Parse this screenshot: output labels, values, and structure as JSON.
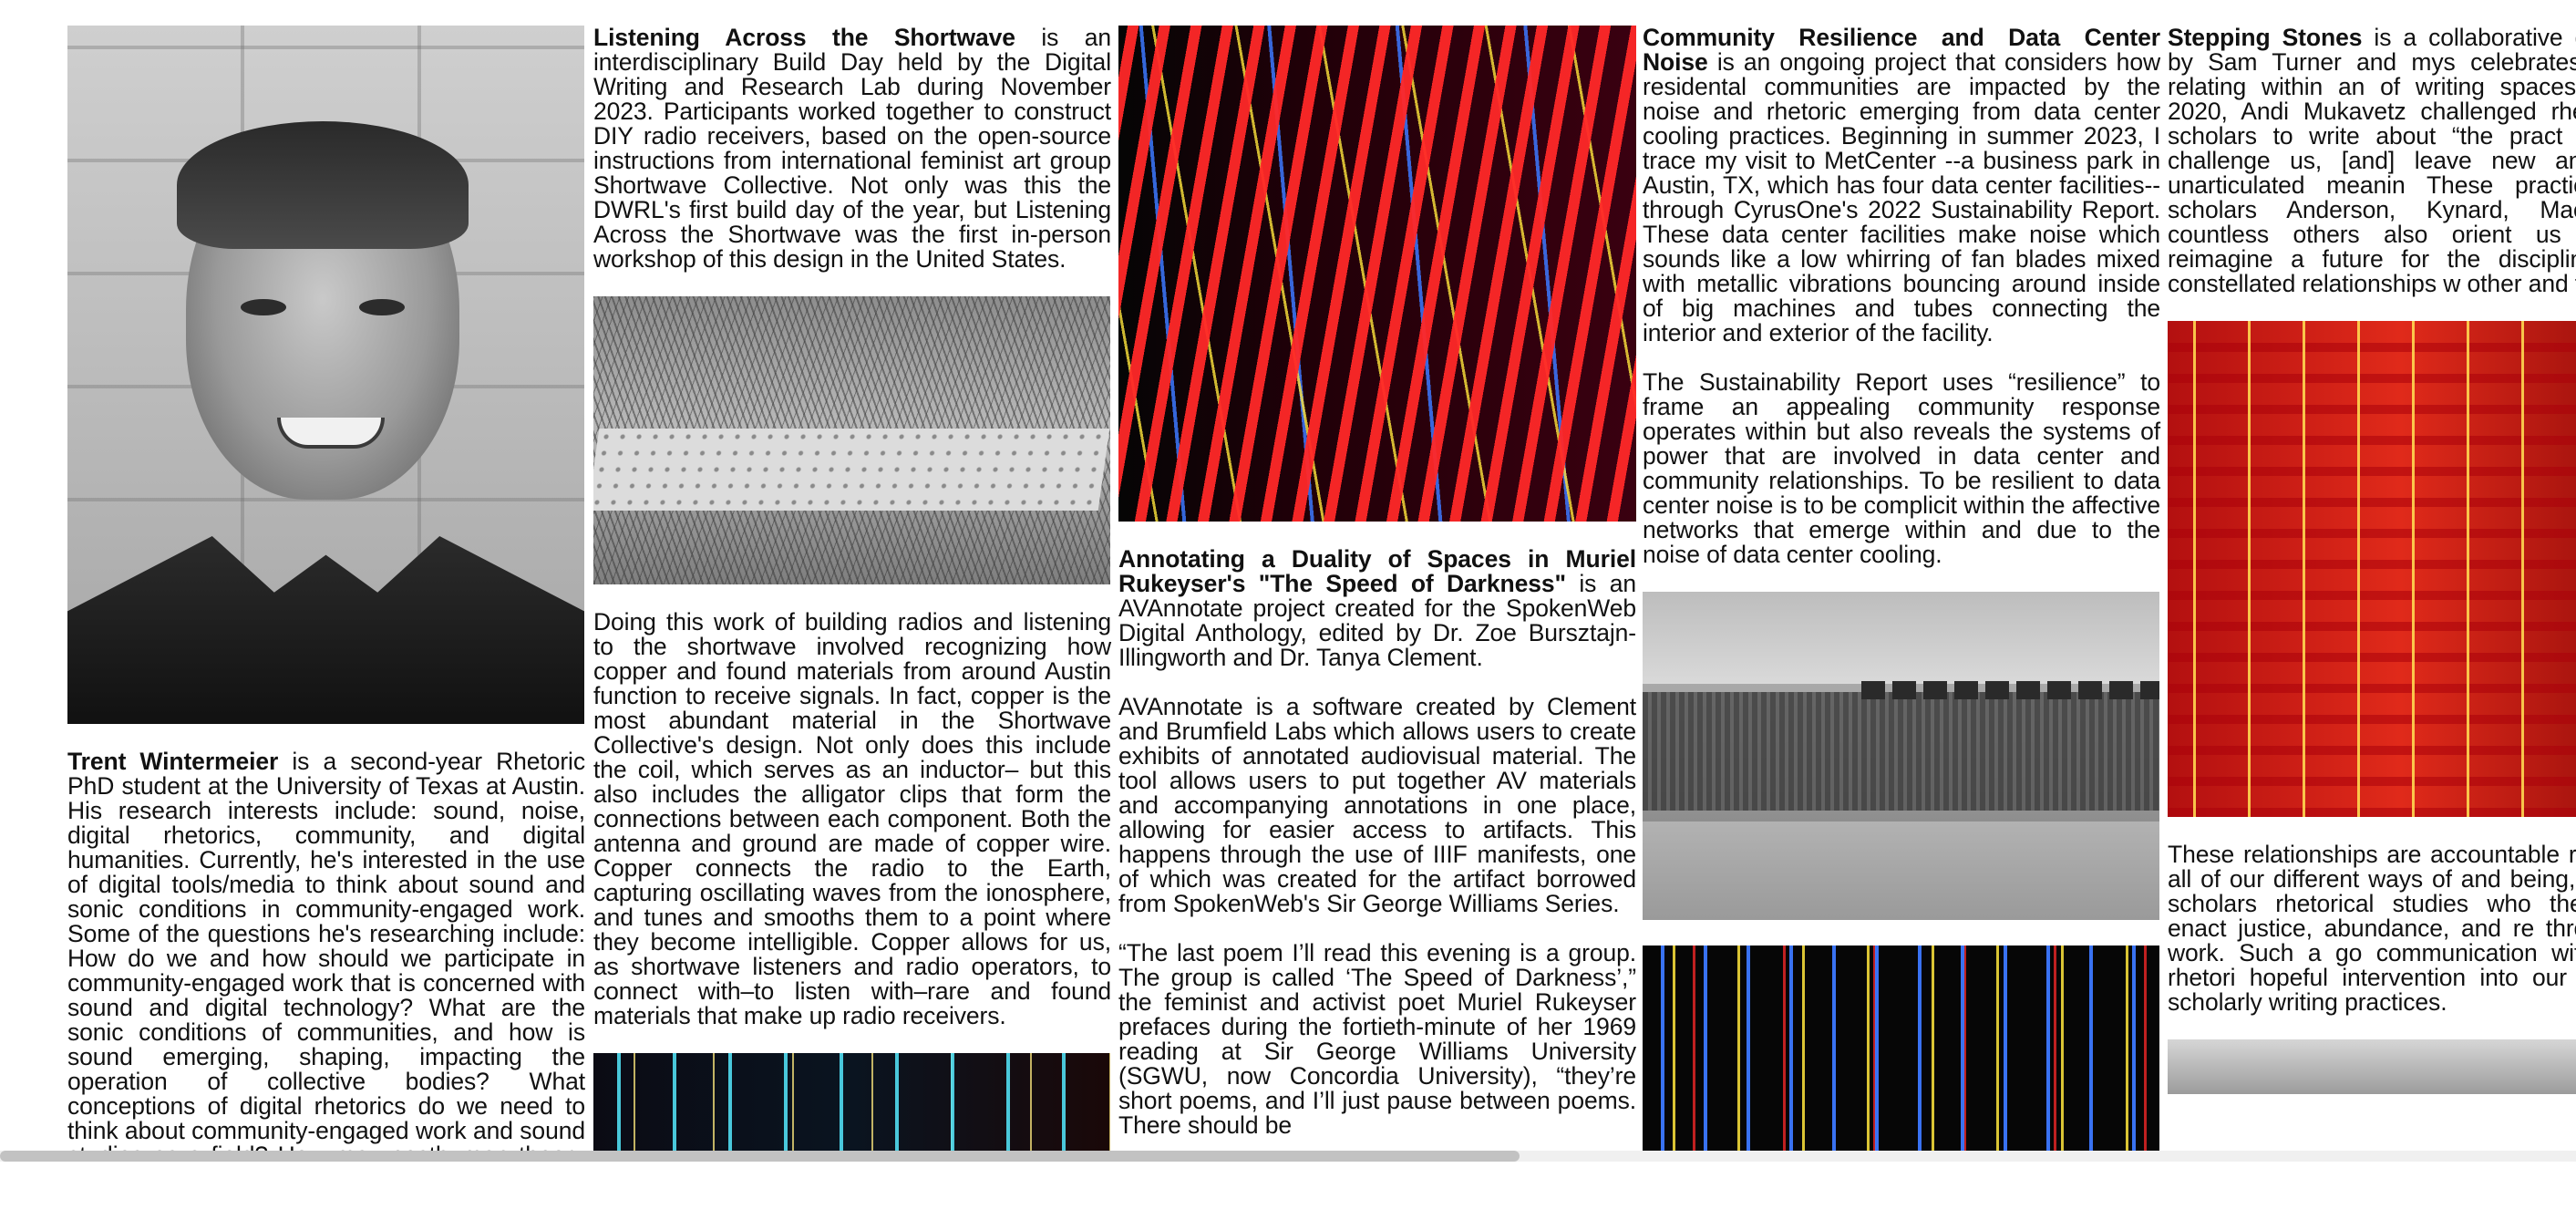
{
  "profile": {
    "name": "Trent Wintermeier",
    "bio": " is a second-year Rhetoric PhD student at the University of Texas at Austin. His research interests include: sound, noise, digital rhetorics, community, and digital humanities. Currently, he's interested in the use of digital tools/media to think about sound and sonic conditions in community-engaged work. Some of the questions he's researching include: How do we and how should we participate in community-engaged work that is concerned with sound and digital technology? What are the sonic conditions of communities, and how is sound emerging, shaping, impacting the operation of collective bodies? What conceptions of digital rhetorics do we need to think about community-engaged work and sound studies as a field? How may posthuman theory function to explain the"
  },
  "shortwave": {
    "title": "Listening Across the Shortwave",
    "intro": " is an interdisciplinary Build Day held by the Digital Writing and Research Lab during November 2023. Participants worked together to construct DIY radio receivers, based on the open-source instructions from international feminist art group Shortwave Collective. Not only was this the DWRL's first build day of the year, but Listening Across the Shortwave was the first in-person workshop of this design in the United States.",
    "body": "Doing this work of building radios and listening to the shortwave involved recognizing how copper and found materials from around Austin function to receive signals. In fact, copper is the most abundant material in the Shortwave Collective's design. Not only does this include the coil, which serves as an inductor– but this also includes the alligator clips that form the connections between each component. Both the antenna and ground are made of copper wire. Copper connects the radio to the Earth, capturing oscillating waves from the ionosphere, and tunes and smooths them to a point where they become intelligible. Copper allows for us, as shortwave listeners and radio operators, to connect with–to listen with–rare and found materials that make up radio receivers."
  },
  "annotating": {
    "title": "Annotating a Duality of Spaces in Muriel Rukeyser's \"The Speed of Darkness\"",
    "intro": " is an AVAnnotate project created for the SpokenWeb Digital Anthology, edited by Dr. Zoe Bursztajn-Illingworth and Dr. Tanya Clement.",
    "body": "AVAnnotate is a software created by Clement and Brumfield Labs which allows users to create exhibits of annotated audiovisual material. The tool allows users to put together AV materials and accompanying annotations in one place, allowing for easier access to artifacts. This happens through the use of IIIF manifests, one of which was created for the artifact borrowed from SpokenWeb's Sir George Williams Series.",
    "quote": "“The last poem I’ll read this evening is a group. The group is called ‘The Speed of Darkness’,” the feminist and activist poet Muriel Rukeyser prefaces during the fortieth-minute of her 1969 reading at Sir George Williams University (SGWU, now Concordia University), “they’re short poems, and I’ll just pause between poems. There should be"
  },
  "resilience": {
    "title": "Community Resilience and Data Center Noise",
    "intro": " is an ongoing project that considers how residental communities are impacted by the noise and rhetoric emerging from data center cooling practices. Beginning in summer 2023, I trace my visit to MetCenter --a business park in Austin, TX, which has four data center facilities--through CyrusOne's 2022 Sustainability Report. These data center facilities make noise which sounds like a low whirring of fan blades mixed with metallic vibrations bouncing around inside of big machines and tubes connecting the interior and exterior of the facility.",
    "body": "The Sustainability Report uses “resilience” to frame an appealing community response operates within but also reveals the systems of power that are involved in data center and community relationships. To be resilient to data center noise is to be complicit within the affective networks that emerge within and due to the noise of data center cooling."
  },
  "stepping": {
    "title": "Stepping Stones",
    "intro": " is a collaborative developed by Sam Turner and mys celebrates ways of relating within an of writing spaces. In June 2020, Andi Mukavetz challenged rhetoric and scholars to write about “the pract scare us, challenge us, [and] leave new answers or unarticulated meanin These practices–which scholars Anderson, Kynard, Mao, Royst countless others also orient us towa us reimagine a future for the disciplin develop constellated relationships w other and the world.",
    "body": "These relationships are accountable reverent of all of our different ways of and being, and echo scholars rhetorical studies who theorize, se enact justice, abundance, and re through their work. Such a go communication with cultural rhetori hopeful intervention into our own pers scholarly writing practices."
  },
  "scrollbar": {
    "position_fraction": 0.0,
    "visible_fraction": 0.59
  }
}
